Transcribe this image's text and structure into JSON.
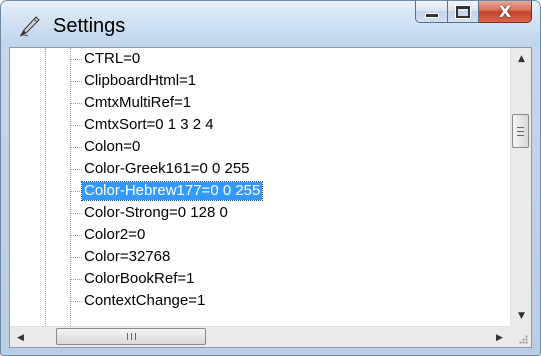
{
  "window": {
    "title": "Settings",
    "icon": "pen-icon"
  },
  "caption": {
    "minimize_icon": "minimize-icon",
    "maximize_icon": "maximize-icon",
    "close_icon": "close-icon",
    "close_glyph": "X",
    "close_color": "#c4402a"
  },
  "tree": {
    "items": [
      "CTRL=0",
      "ClipboardHtml=1",
      "CmtxMultiRef=1",
      "CmtxSort=0 1 3 2 4",
      "Colon=0",
      "Color-Greek161=0 0 255",
      "Color-Hebrew177=0 0 255",
      "Color-Strong=0 128 0",
      "Color2=0",
      "Color=32768",
      "ColorBookRef=1",
      "ContextChange=1"
    ],
    "selected_item": "Color-Hebrew177=0 0 255",
    "selection_color": "#3399ff"
  },
  "scrollbars": {
    "up_arrow": "▲",
    "down_arrow": "▼",
    "left_arrow": "◀",
    "right_arrow": "▶"
  }
}
